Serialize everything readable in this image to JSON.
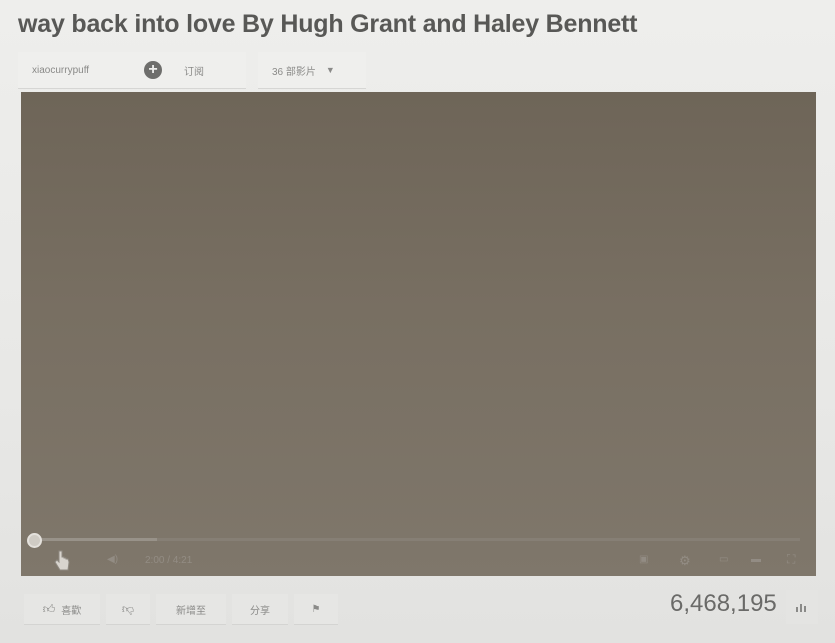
{
  "video": {
    "title": "way back into love By Hugh Grant and Haley Bennett",
    "view_count": "6,468,195"
  },
  "channel": {
    "name": "xiaocurrypuff",
    "subscribe_label": "订阅",
    "video_count_label": "36 部影片"
  },
  "player": {
    "time_label": "2:00 / 4:21",
    "progress_fraction": 0.0
  },
  "actions": {
    "like_label": "喜歡",
    "add_to_label": "新增至",
    "share_label": "分享"
  },
  "icons": {
    "subscribe": "plus-circle-icon",
    "like": "thumbs-up-icon",
    "dislike": "thumbs-down-icon",
    "flag": "flag-icon",
    "stats": "stats-icon"
  },
  "colors": {
    "title": "#585856",
    "player_bg": "#786f62",
    "page_bg": "#e9e9e7"
  }
}
